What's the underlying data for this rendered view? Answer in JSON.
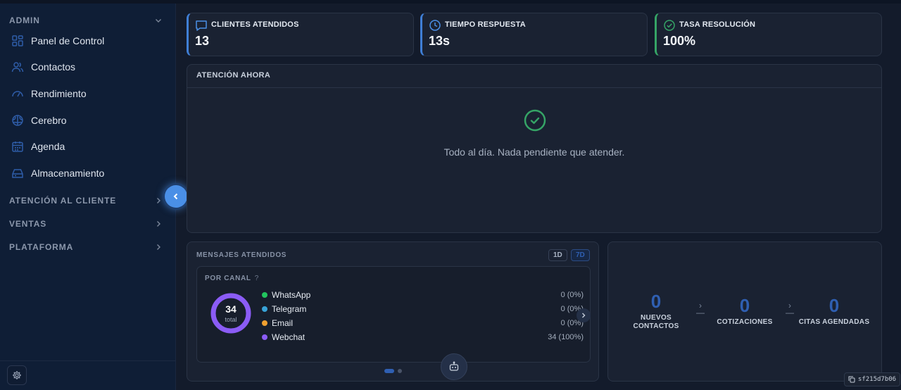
{
  "sidebar": {
    "sections": [
      {
        "label": "ADMIN",
        "expanded": true
      },
      {
        "label": "ATENCIÓN AL CLIENTE",
        "expanded": false
      },
      {
        "label": "VENTAS",
        "expanded": false
      },
      {
        "label": "PLATAFORMA",
        "expanded": false
      }
    ],
    "items": [
      {
        "label": "Panel de Control",
        "icon": "grid-icon"
      },
      {
        "label": "Contactos",
        "icon": "users-icon"
      },
      {
        "label": "Rendimiento",
        "icon": "gauge-icon"
      },
      {
        "label": "Cerebro",
        "icon": "brain-icon"
      },
      {
        "label": "Agenda",
        "icon": "calendar-icon"
      },
      {
        "label": "Almacenamiento",
        "icon": "storage-icon"
      }
    ]
  },
  "stats": [
    {
      "label": "CLIENTES ATENDIDOS",
      "value": "13",
      "icon": "chat-icon"
    },
    {
      "label": "TIEMPO RESPUESTA",
      "value": "13s",
      "icon": "clock-icon"
    },
    {
      "label": "TASA RESOLUCIÓN",
      "value": "100%",
      "icon": "check-circle-icon"
    }
  ],
  "attention": {
    "title": "ATENCIÓN AHORA",
    "message": "Todo al día. Nada pendiente que atender."
  },
  "messages": {
    "title": "MENSAJES ATENDIDOS",
    "ranges": [
      "1D",
      "7D"
    ],
    "selected_range": "7D",
    "by_channel": {
      "title": "POR CANAL",
      "help": "?",
      "total": "34",
      "total_label": "total",
      "channels": [
        {
          "name": "WhatsApp",
          "value": "0 (0%)",
          "color": "#22c55e"
        },
        {
          "name": "Telegram",
          "value": "0 (0%)",
          "color": "#38a3d8"
        },
        {
          "name": "Email",
          "value": "0 (0%)",
          "color": "#f0a030"
        },
        {
          "name": "Webchat",
          "value": "34 (100%)",
          "color": "#8b5cf6"
        }
      ]
    }
  },
  "funnel": [
    {
      "value": "0",
      "label": "NUEVOS CONTACTOS"
    },
    {
      "value": "0",
      "label": "COTIZACIONES"
    },
    {
      "value": "0",
      "label": "CITAS AGENDADAS"
    }
  ],
  "build_id": "sf215d7b06",
  "colors": {
    "accent": "#4a8fe6",
    "success": "#35a466",
    "webchat": "#8b5cf6"
  }
}
